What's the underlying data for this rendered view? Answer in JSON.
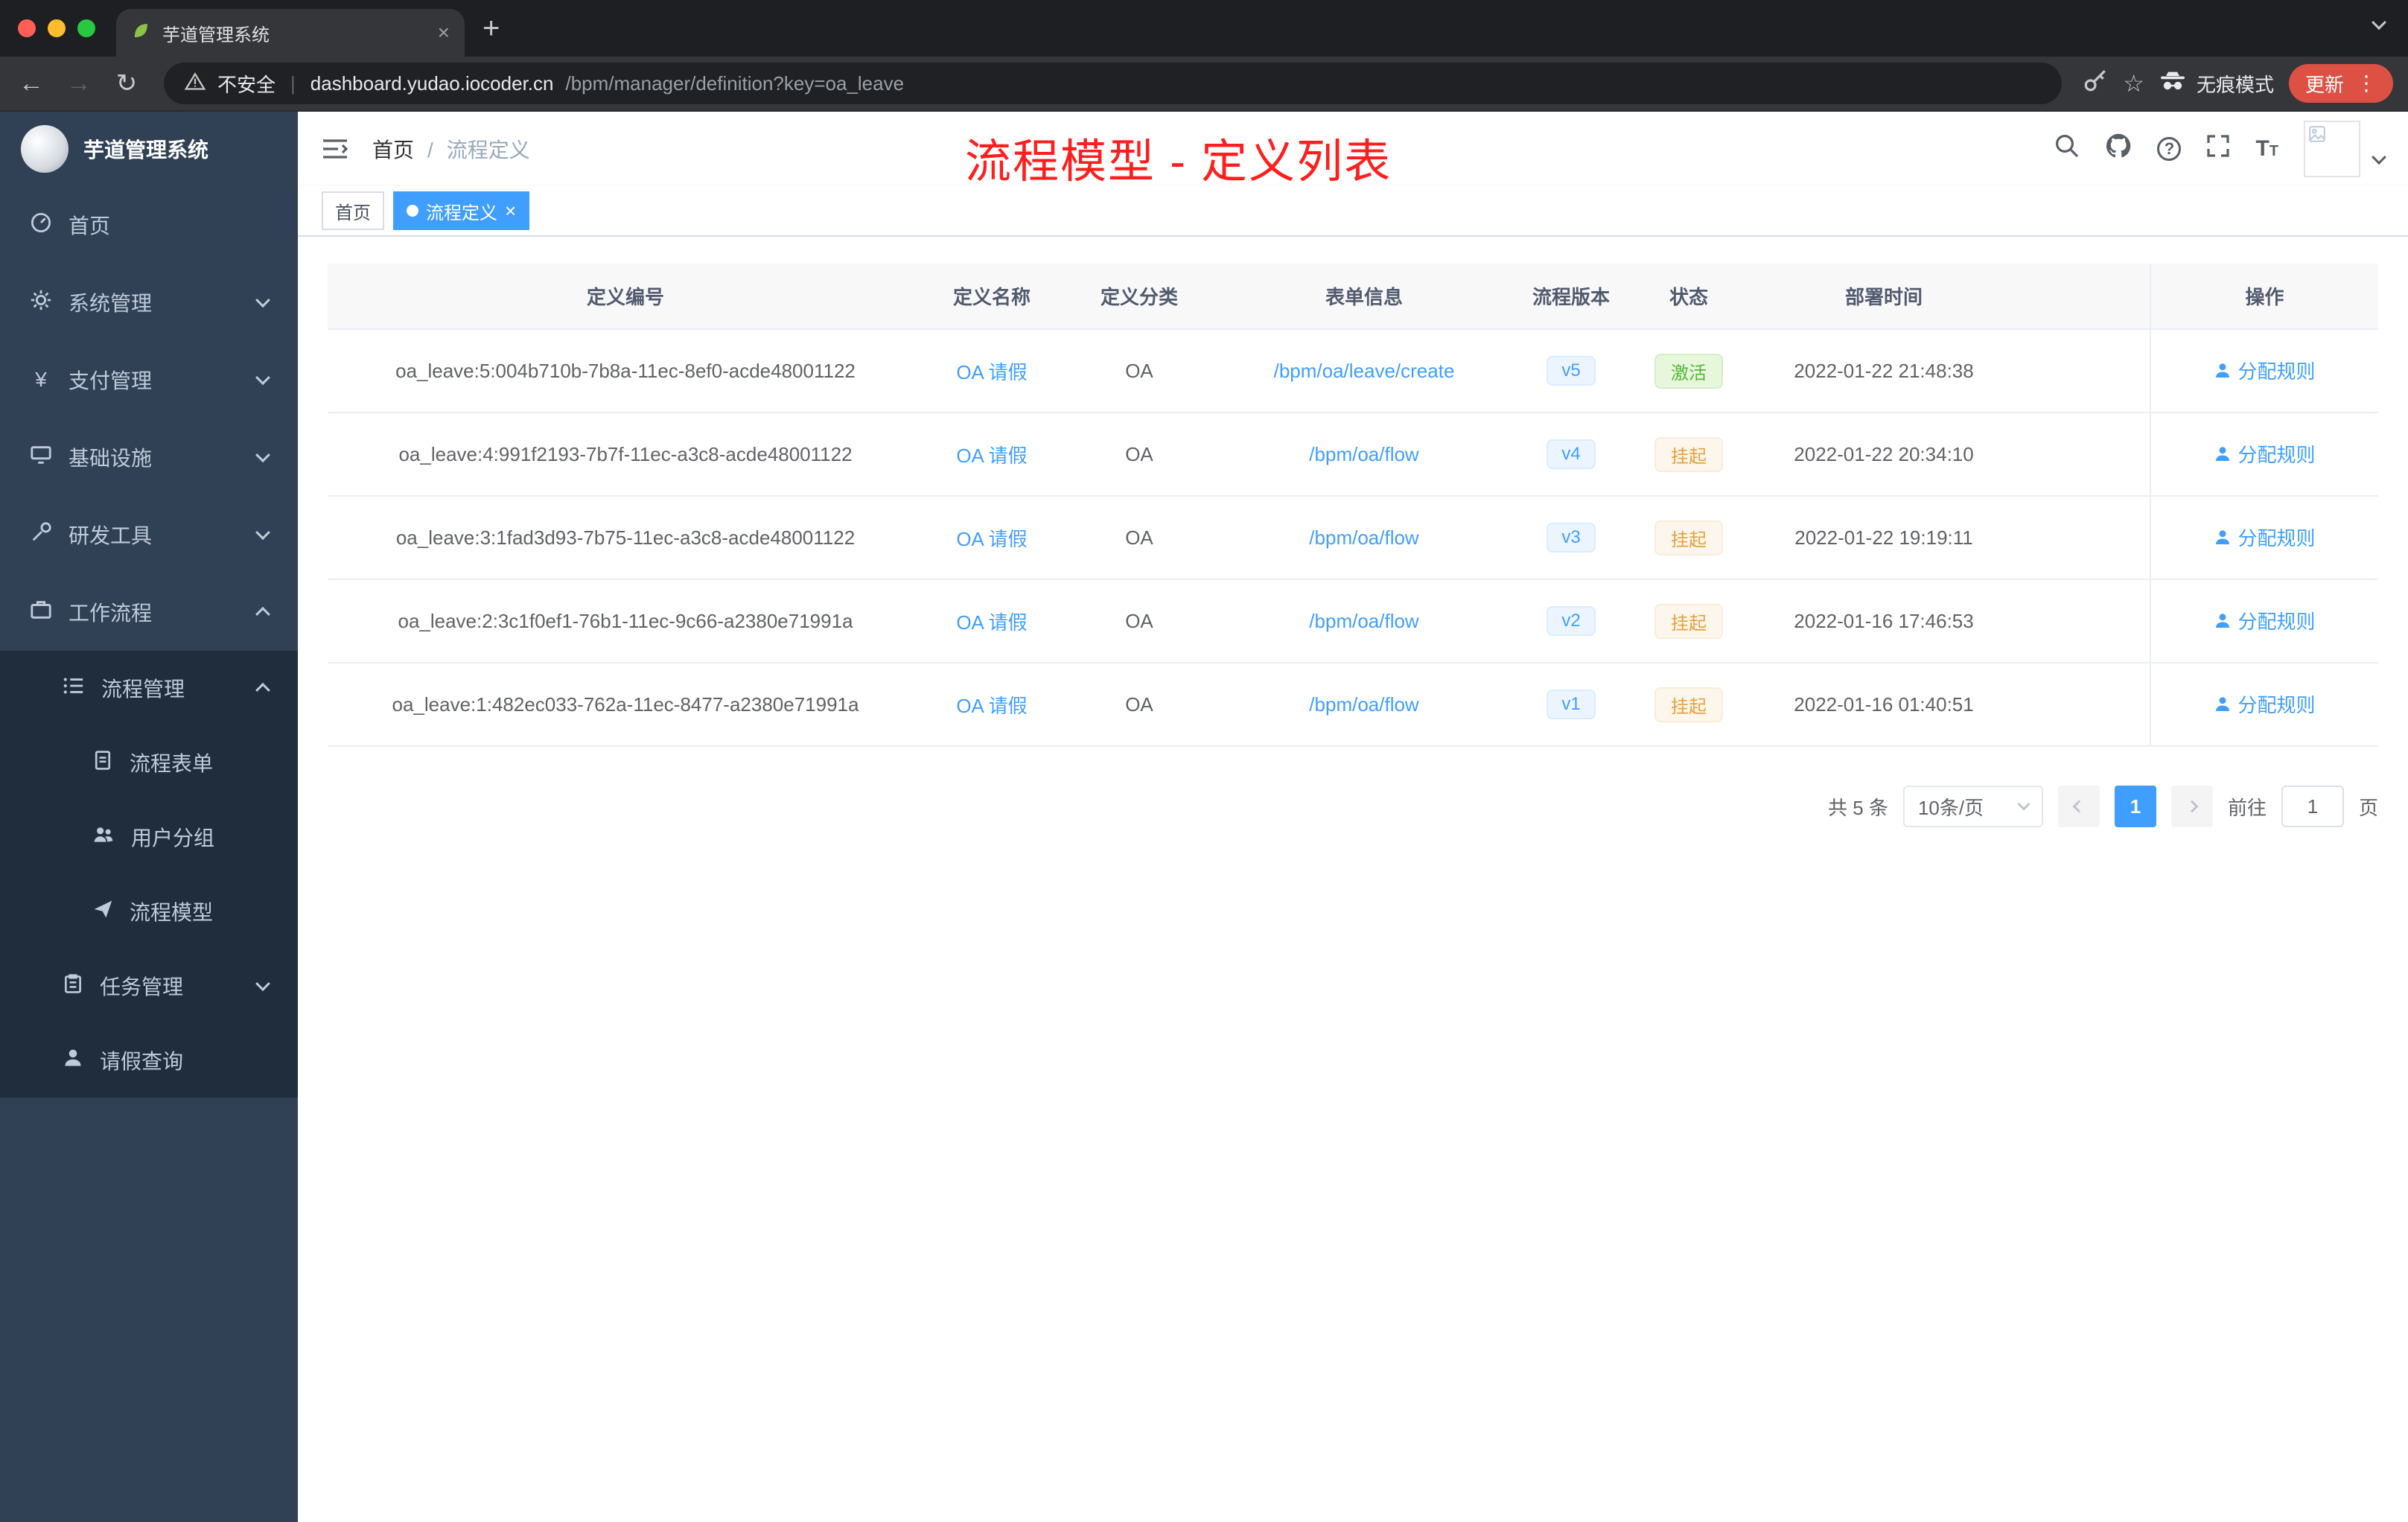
{
  "browser": {
    "tab_title": "芋道管理系统",
    "security_label": "不安全",
    "url_host": "dashboard.yudao.iocoder.cn",
    "url_path": "/bpm/manager/definition?key=oa_leave",
    "incognito_label": "无痕模式",
    "update_label": "更新"
  },
  "sidebar": {
    "logo_title": "芋道管理系统",
    "items": [
      {
        "label": "首页"
      },
      {
        "label": "系统管理"
      },
      {
        "label": "支付管理"
      },
      {
        "label": "基础设施"
      },
      {
        "label": "研发工具"
      },
      {
        "label": "工作流程"
      },
      {
        "label": "流程管理"
      },
      {
        "label": "流程表单"
      },
      {
        "label": "用户分组"
      },
      {
        "label": "流程模型"
      },
      {
        "label": "任务管理"
      },
      {
        "label": "请假查询"
      }
    ]
  },
  "header": {
    "breadcrumb": {
      "home": "首页",
      "sep": "/",
      "current": "流程定义"
    },
    "annotation": "流程模型 - 定义列表"
  },
  "tags": {
    "home": "首页",
    "active": "流程定义"
  },
  "table": {
    "columns": [
      "定义编号",
      "定义名称",
      "定义分类",
      "表单信息",
      "流程版本",
      "状态",
      "部署时间",
      "操作"
    ],
    "rows": [
      {
        "id": "oa_leave:5:004b710b-7b8a-11ec-8ef0-acde48001122",
        "name": "OA 请假",
        "category": "OA",
        "form": "/bpm/oa/leave/create",
        "version": "v5",
        "status": "激活",
        "status_type": "success",
        "time": "2022-01-22 21:48:38",
        "action": "分配规则"
      },
      {
        "id": "oa_leave:4:991f2193-7b7f-11ec-a3c8-acde48001122",
        "name": "OA 请假",
        "category": "OA",
        "form": "/bpm/oa/flow",
        "version": "v4",
        "status": "挂起",
        "status_type": "warning",
        "time": "2022-01-22 20:34:10",
        "action": "分配规则"
      },
      {
        "id": "oa_leave:3:1fad3d93-7b75-11ec-a3c8-acde48001122",
        "name": "OA 请假",
        "category": "OA",
        "form": "/bpm/oa/flow",
        "version": "v3",
        "status": "挂起",
        "status_type": "warning",
        "time": "2022-01-22 19:19:11",
        "action": "分配规则"
      },
      {
        "id": "oa_leave:2:3c1f0ef1-76b1-11ec-9c66-a2380e71991a",
        "name": "OA 请假",
        "category": "OA",
        "form": "/bpm/oa/flow",
        "version": "v2",
        "status": "挂起",
        "status_type": "warning",
        "time": "2022-01-16 17:46:53",
        "action": "分配规则"
      },
      {
        "id": "oa_leave:1:482ec033-762a-11ec-8477-a2380e71991a",
        "name": "OA 请假",
        "category": "OA",
        "form": "/bpm/oa/flow",
        "version": "v1",
        "status": "挂起",
        "status_type": "warning",
        "time": "2022-01-16 01:40:51",
        "action": "分配规则"
      }
    ]
  },
  "pagination": {
    "total": "共 5 条",
    "page_size": "10条/页",
    "page": "1",
    "goto": "前往",
    "unit": "页",
    "goto_value": "1"
  },
  "colors": {
    "accent": "#409eff",
    "sidebar_bg": "#304156",
    "submenu_bg": "#1f2d3d",
    "annotation_red": "#ff1e1e",
    "success_green": "#52b837",
    "warning_orange": "#e6a23c"
  },
  "icons": {
    "tab_favicon": "leaf-icon",
    "navbar": [
      "search-icon",
      "github-icon",
      "help-icon",
      "fullscreen-icon",
      "font-size-icon"
    ],
    "action": "person-icon"
  }
}
